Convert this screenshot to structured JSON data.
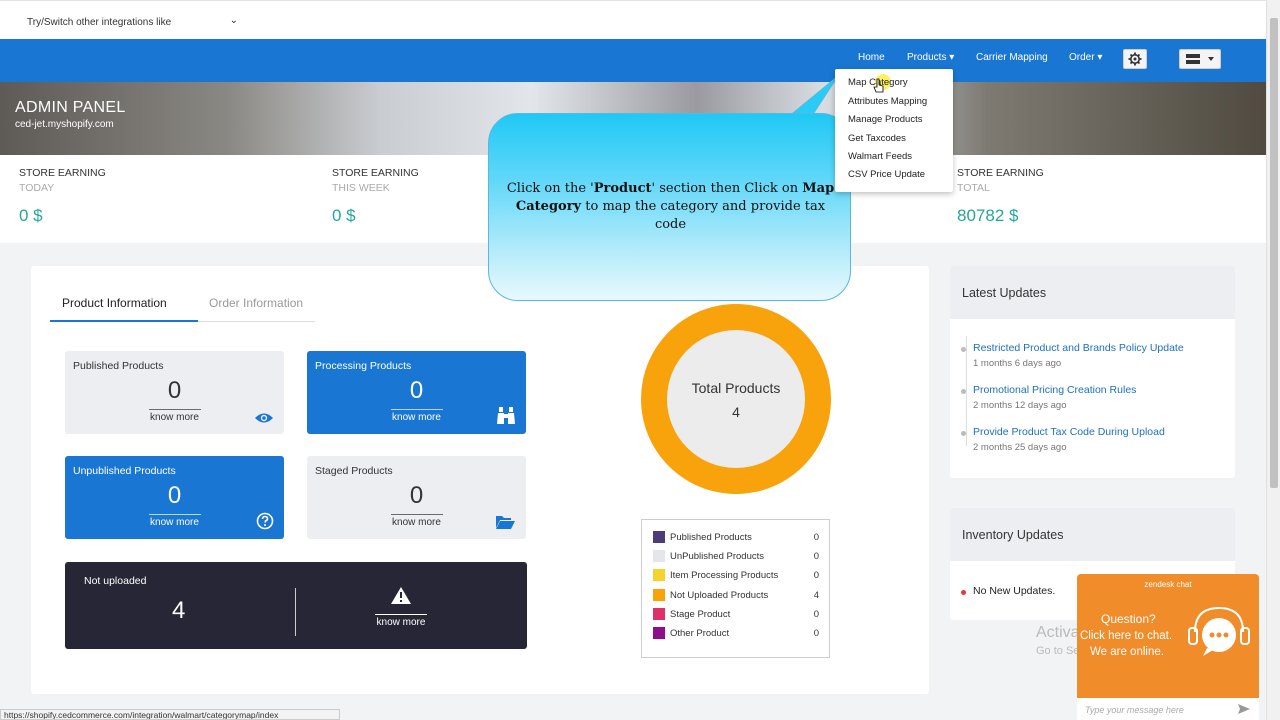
{
  "top": {
    "integration_select": "Try/Switch other integrations like"
  },
  "nav": {
    "home": "Home",
    "products": "Products",
    "carrier": "Carrier Mapping",
    "order": "Order"
  },
  "banner": {
    "title": "ADMIN PANEL",
    "store": "ced-jet.myshopify.com"
  },
  "stats": [
    {
      "title": "STORE EARNING",
      "period": "TODAY",
      "value": "0 $"
    },
    {
      "title": "STORE EARNING",
      "period": "THIS WEEK",
      "value": "0 $"
    },
    {
      "title": "STORE EARNING",
      "period": "TOTAL",
      "value": "80782 $"
    }
  ],
  "tabs": {
    "product": "Product Information",
    "order": "Order Information"
  },
  "boxes": {
    "published": {
      "label": "Published Products",
      "value": "0",
      "more": "know more"
    },
    "processing": {
      "label": "Processing Products",
      "value": "0",
      "more": "know more"
    },
    "unpublished": {
      "label": "Unpublished Products",
      "value": "0",
      "more": "know more"
    },
    "staged": {
      "label": "Staged Products",
      "value": "0",
      "more": "know more"
    },
    "not_uploaded": {
      "label": "Not uploaded",
      "value": "4",
      "more": "know more"
    }
  },
  "donut": {
    "label": "Total Products",
    "value": "4"
  },
  "legend": [
    {
      "name": "Published Products",
      "value": "0",
      "color": "#4b3b78"
    },
    {
      "name": "UnPublished Products",
      "value": "0",
      "color": "#e4e6ea"
    },
    {
      "name": "Item Processing Products",
      "value": "0",
      "color": "#f5d22e"
    },
    {
      "name": "Not Uploaded Products",
      "value": "4",
      "color": "#f9a30c"
    },
    {
      "name": "Stage Product",
      "value": "0",
      "color": "#e0306a"
    },
    {
      "name": "Other Product",
      "value": "0",
      "color": "#8e0f8e"
    }
  ],
  "latest": {
    "title": "Latest Updates",
    "items": [
      {
        "title": "Restricted Product and Brands Policy Update",
        "time": "1 months 6 days ago"
      },
      {
        "title": "Promotional Pricing Creation Rules",
        "time": "2 months 12 days ago"
      },
      {
        "title": "Provide Product Tax Code During Upload",
        "time": "2 months 25 days ago"
      }
    ]
  },
  "inventory": {
    "title": "Inventory Updates",
    "text": "No New Updates."
  },
  "dropdown": [
    "Map Category",
    "Attributes Mapping",
    "Manage Products",
    "Get Taxcodes",
    "Walmart Feeds",
    "CSV Price Update"
  ],
  "callout": {
    "t1": "Click on the '",
    "b1": "Product",
    "t2": "' section then Click on ",
    "b2": "Map Category",
    "t3": " to map the category and provide tax code"
  },
  "watermark": {
    "line1": "Activa",
    "line2": "Go to Se"
  },
  "chat": {
    "brand": "zendesk chat",
    "question": "Question?",
    "line1": "Click here to chat.",
    "line2": "We are online.",
    "placeholder": "Type your message here"
  },
  "statusbar": "https://shopify.cedcommerce.com/integration/walmart/categorymap/index"
}
